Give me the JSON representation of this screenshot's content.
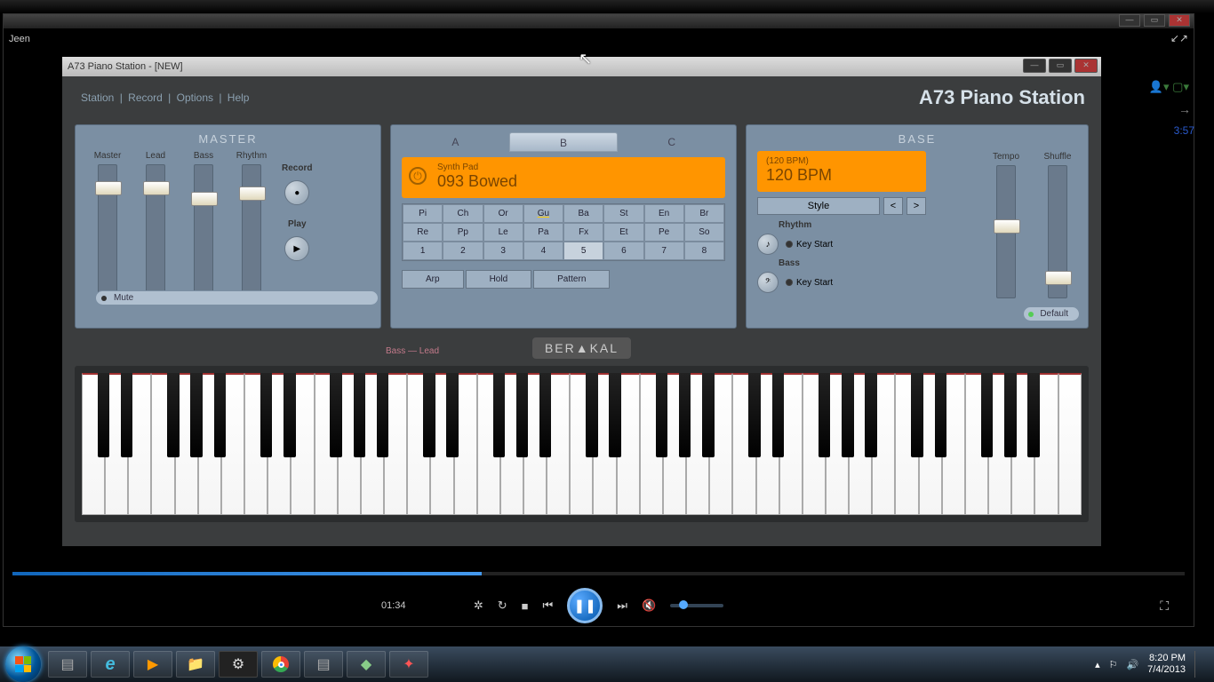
{
  "outer_title_truncated": "Jeen",
  "piano": {
    "window_title": "A73 Piano Station - [NEW]",
    "menu": [
      "Station",
      "Record",
      "Options",
      "Help"
    ],
    "brand": "A73 Piano Station",
    "master": {
      "title": "MASTER",
      "sliders": [
        {
          "label": "Master",
          "pos": 18
        },
        {
          "label": "Lead",
          "pos": 18
        },
        {
          "label": "Bass",
          "pos": 30
        },
        {
          "label": "Rhythm",
          "pos": 24
        }
      ],
      "mute": "Mute",
      "record": "Record",
      "play": "Play"
    },
    "center": {
      "tabs": [
        "A",
        "B",
        "C"
      ],
      "active_tab": "B",
      "patch_category": "Synth Pad",
      "patch_name": "093 Bowed",
      "grid_row1": [
        "Pi",
        "Ch",
        "Or",
        "Gu",
        "Ba",
        "St",
        "En",
        "Br"
      ],
      "grid_row2": [
        "Re",
        "Pp",
        "Le",
        "Pa",
        "Fx",
        "Et",
        "Pe",
        "So"
      ],
      "grid_row3": [
        "1",
        "2",
        "3",
        "4",
        "5",
        "6",
        "7",
        "8"
      ],
      "grid_highlight_r1": "Gu",
      "grid_highlight_r3": "5",
      "modes": [
        "Arp",
        "Hold",
        "Pattern"
      ]
    },
    "base": {
      "title": "BASE",
      "bpm_small": "(120 BPM)",
      "bpm_big": "120 BPM",
      "style": "Style",
      "rhythm": "Rhythm",
      "bass": "Bass",
      "keystart": "Key Start",
      "sliders": [
        {
          "label": "Tempo",
          "pos": 60
        },
        {
          "label": "Shuffle",
          "pos": 118
        }
      ],
      "default": "Default"
    },
    "watermark": "BER▲KAL",
    "zone_hint": "Bass — Lead"
  },
  "wmp": {
    "elapsed": "01:34",
    "total": "3:57",
    "progress_pct": 40
  },
  "tray": {
    "time": "8:20 PM",
    "date": "7/4/2013"
  }
}
